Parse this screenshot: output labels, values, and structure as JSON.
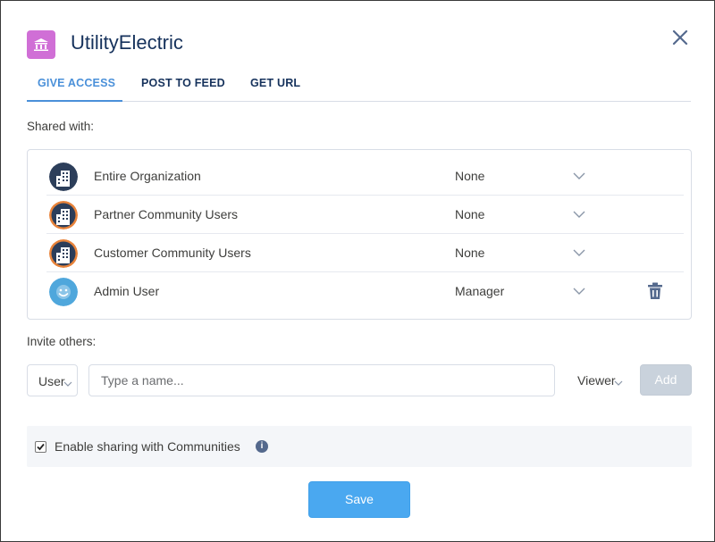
{
  "dialog": {
    "title": "UtilityElectric",
    "icon": "bank-icon",
    "accent": "#d06fd6"
  },
  "tabs": [
    {
      "label": "GIVE ACCESS",
      "active": true
    },
    {
      "label": "POST TO FEED",
      "active": false
    },
    {
      "label": "GET URL",
      "active": false
    }
  ],
  "shared": {
    "label": "Shared with:",
    "rows": [
      {
        "name": "Entire Organization",
        "level": "None",
        "avatar": "building-icon",
        "ring": false
      },
      {
        "name": "Partner Community Users",
        "level": "None",
        "avatar": "building-icon",
        "ring": true
      },
      {
        "name": "Customer Community Users",
        "level": "None",
        "avatar": "building-icon",
        "ring": true
      },
      {
        "name": "Admin User",
        "level": "Manager",
        "avatar": "user-smiley-icon",
        "ring": false,
        "removable": true
      }
    ]
  },
  "invite": {
    "label": "Invite others:",
    "type_value": "User",
    "name_placeholder": "Type a name...",
    "access_value": "Viewer",
    "add_label": "Add"
  },
  "communities": {
    "checked": true,
    "label": "Enable sharing with Communities",
    "info_glyph": "i"
  },
  "footer": {
    "save_label": "Save"
  },
  "colors": {
    "tab_active": "#4a90d9",
    "save": "#4aa8f0",
    "add_disabled": "#c9d2dc",
    "community_ring": "#e8833a",
    "avatar_dark": "#2c3e5a",
    "avatar_user": "#4fa7dc"
  }
}
